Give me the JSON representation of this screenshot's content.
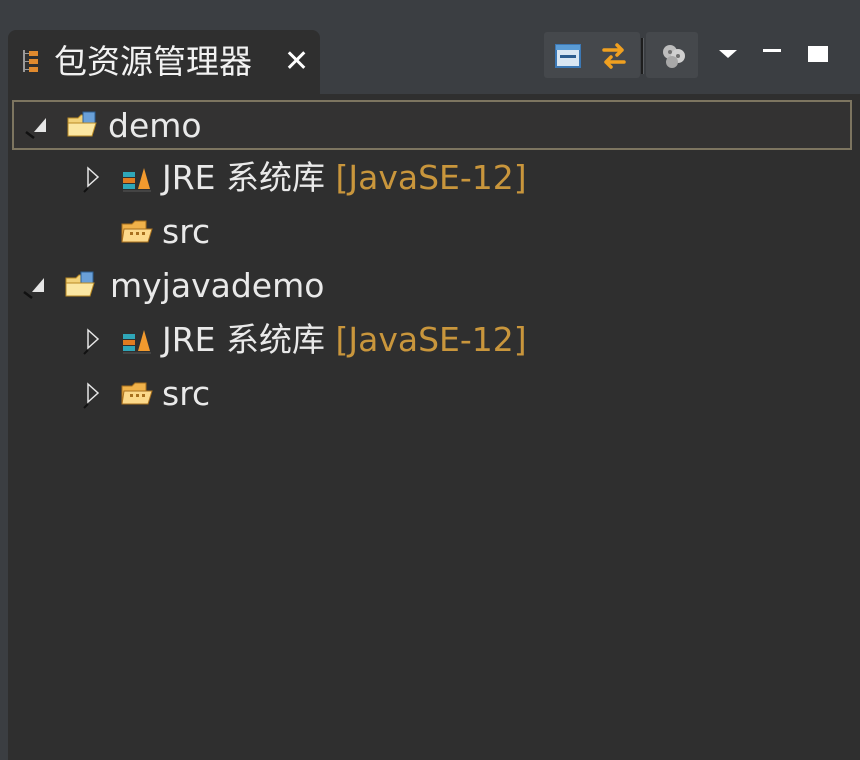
{
  "view": {
    "tab_title": "包资源管理器",
    "close_label": "✕"
  },
  "toolbar": {
    "items": [
      {
        "name": "collapse-all-button",
        "icon": "collapse-all-icon"
      },
      {
        "name": "link-with-editor-button",
        "icon": "link-with-editor-icon"
      },
      {
        "name": "focus-on-active-task-button",
        "icon": "focus-task-icon"
      },
      {
        "name": "view-menu-button",
        "icon": "chevron-down-icon"
      },
      {
        "name": "minimize-button",
        "icon": "minimize-icon"
      },
      {
        "name": "maximize-button",
        "icon": "maximize-icon"
      }
    ]
  },
  "tree": {
    "projects": [
      {
        "name": "demo",
        "expanded": true,
        "selected": true,
        "children": [
          {
            "label": "JRE 系统库",
            "decoration": "[JavaSE-12]",
            "expandable": true,
            "type": "library"
          },
          {
            "label": "src",
            "decoration": "",
            "expandable": false,
            "type": "source-folder"
          }
        ]
      },
      {
        "name": "myjavademo",
        "expanded": true,
        "selected": false,
        "children": [
          {
            "label": "JRE 系统库",
            "decoration": "[JavaSE-12]",
            "expandable": true,
            "type": "library"
          },
          {
            "label": "src",
            "decoration": "",
            "expandable": true,
            "type": "source-folder"
          }
        ]
      }
    ]
  },
  "colors": {
    "background": "#2f2f2f",
    "text": "#e9e9e9",
    "decoration": "#c9963c",
    "selection_border": "#7d7560"
  }
}
